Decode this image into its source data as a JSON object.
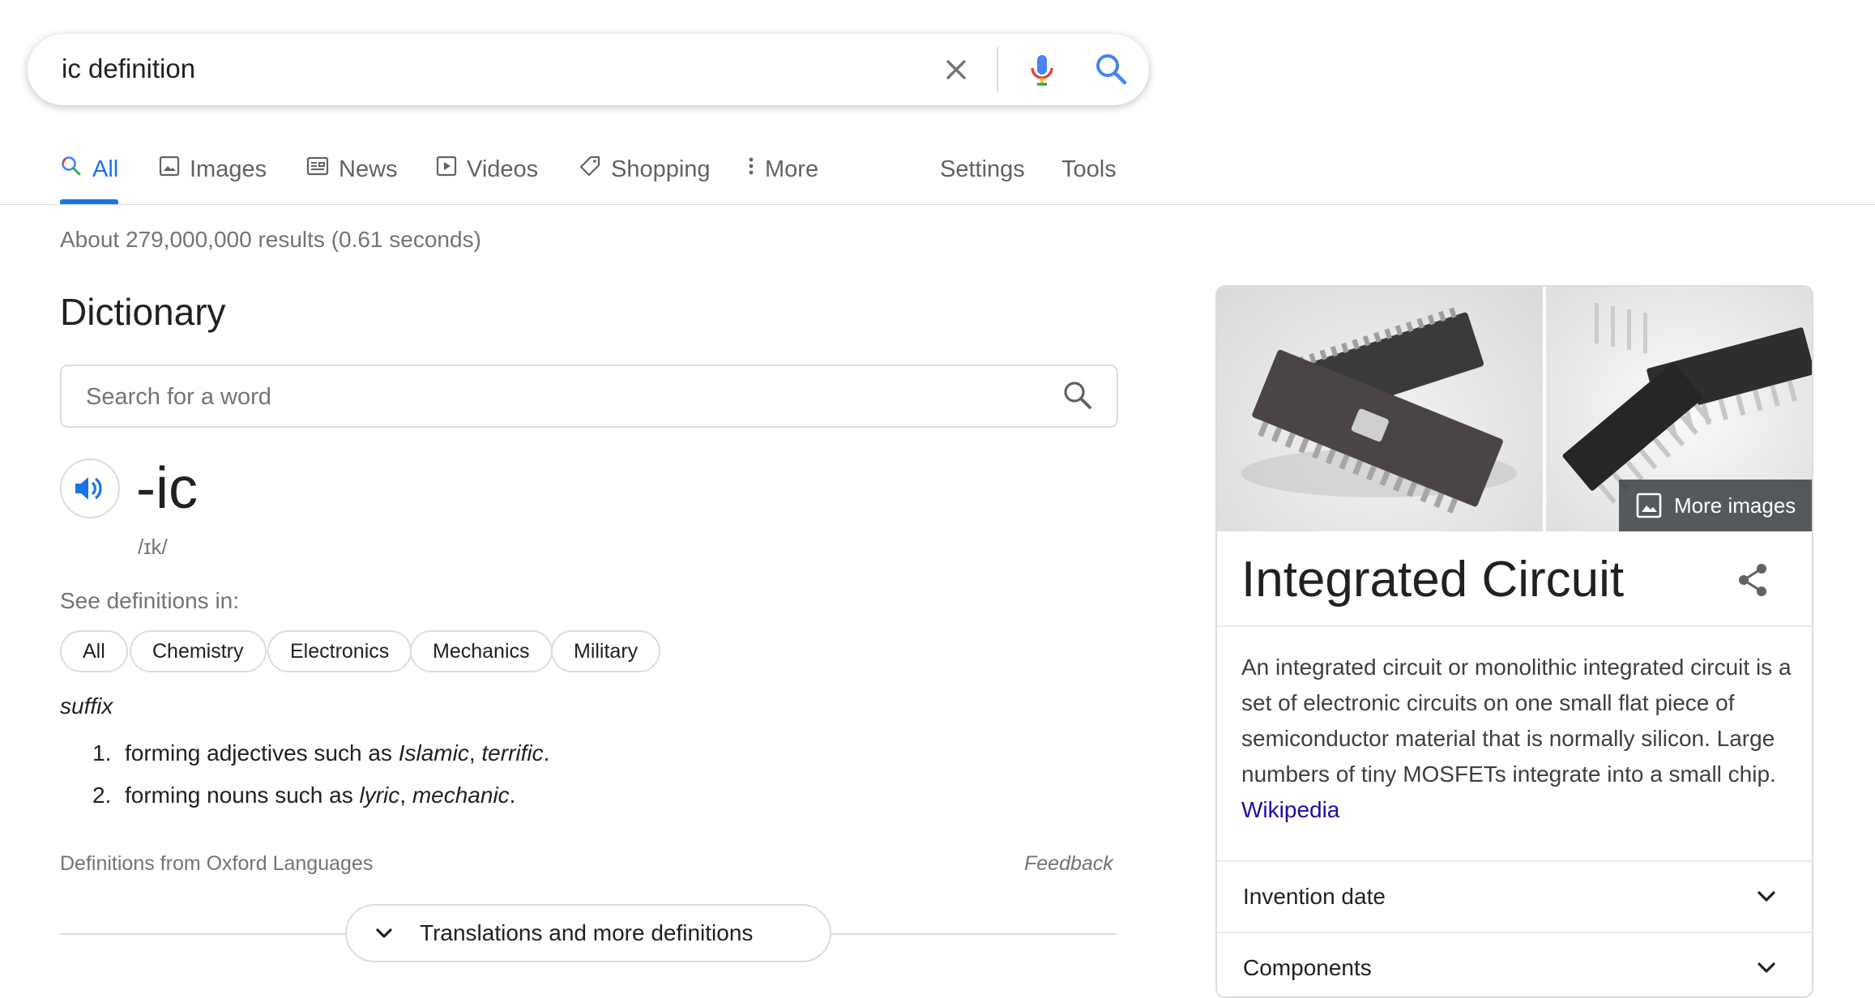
{
  "search": {
    "query": "ic definition"
  },
  "tabs": [
    {
      "label": "All",
      "icon": "search-multicolor-icon",
      "active": true
    },
    {
      "label": "Images",
      "icon": "image-icon"
    },
    {
      "label": "News",
      "icon": "news-icon"
    },
    {
      "label": "Videos",
      "icon": "video-icon"
    },
    {
      "label": "Shopping",
      "icon": "tag-icon"
    },
    {
      "label": "More",
      "icon": "more-vert-icon"
    },
    {
      "label": "Settings"
    },
    {
      "label": "Tools"
    }
  ],
  "result_stats": "About 279,000,000 results (0.61 seconds)",
  "dictionary": {
    "heading": "Dictionary",
    "search_placeholder": "Search for a word",
    "word": "-ic",
    "phonetic": "/ɪk/",
    "see_definitions_label": "See definitions in:",
    "chips": [
      "All",
      "Chemistry",
      "Electronics",
      "Mechanics",
      "Military"
    ],
    "part_of_speech": "suffix",
    "definitions": [
      {
        "num": "1.",
        "text": "forming adjectives such as ",
        "ex1": "Islamic",
        "sep": ", ",
        "ex2": "terrific",
        "end": "."
      },
      {
        "num": "2.",
        "text": "forming nouns such as ",
        "ex1": "lyric",
        "sep": ", ",
        "ex2": "mechanic",
        "end": "."
      }
    ],
    "source": "Definitions from Oxford Languages",
    "feedback": "Feedback",
    "translations_label": "Translations and more definitions"
  },
  "knowledge_panel": {
    "more_images": "More images",
    "title": "Integrated Circuit",
    "description": "An integrated circuit or monolithic integrated circuit is a set of electronic circuits on one small flat piece of semiconductor material that is normally silicon. Large numbers of tiny MOSFETs integrate into a small chip.",
    "source_link": "Wikipedia",
    "rows": [
      {
        "label": "Invention date"
      },
      {
        "label": "Components"
      }
    ]
  },
  "colors": {
    "accent": "#1a73e8",
    "link": "#1a0dab",
    "muted": "#70757a",
    "border": "#dadce0"
  }
}
